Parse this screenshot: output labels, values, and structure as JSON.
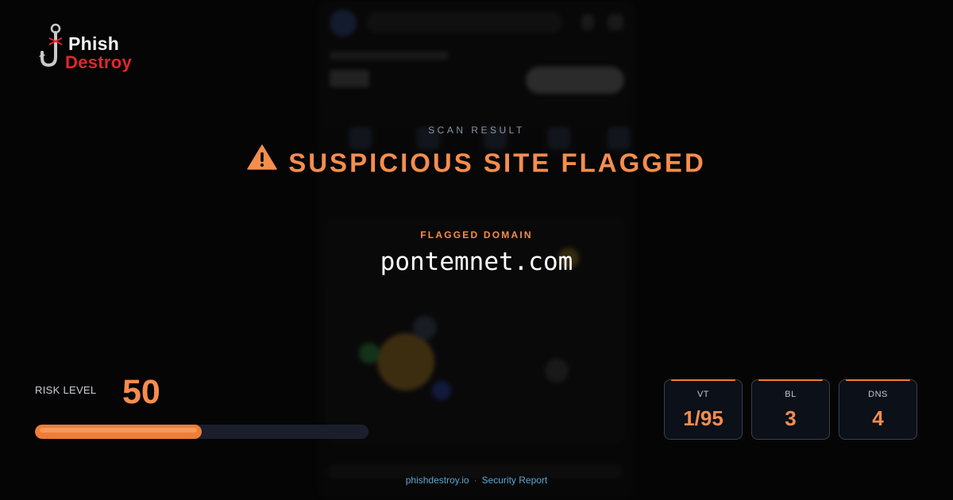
{
  "brand": {
    "line1": "Phish",
    "line2": "Destroy"
  },
  "scan": {
    "label": "SCAN RESULT",
    "headline": "SUSPICIOUS SITE FLAGGED",
    "warning_icon": "warning-triangle-icon",
    "headline_color": "#f68d4e"
  },
  "flagged": {
    "label": "FLAGGED DOMAIN",
    "domain": "pontemnet.com"
  },
  "risk": {
    "label": "RISK LEVEL",
    "value": "50",
    "level_percent": 50,
    "bar_color": "#f07d36"
  },
  "stats": [
    {
      "name": "VT",
      "value": "1/95"
    },
    {
      "name": "BL",
      "value": "3"
    },
    {
      "name": "DNS",
      "value": "4"
    }
  ],
  "footer": {
    "site": "phishdestroy.io",
    "separator": "·",
    "report": "Security Report"
  }
}
